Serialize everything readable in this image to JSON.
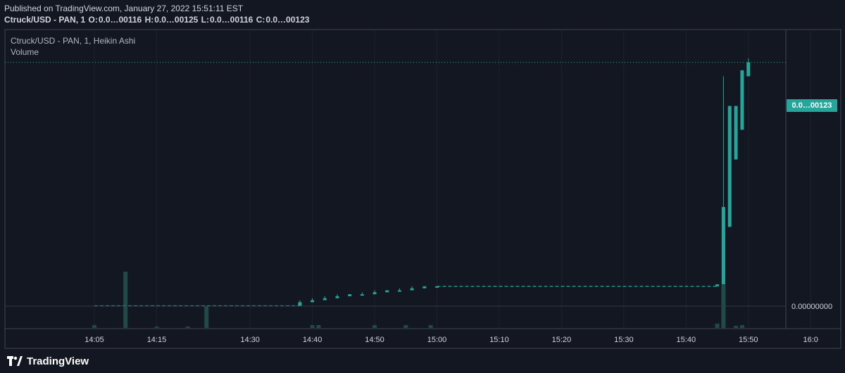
{
  "header": {
    "published": "Published on TradingView.com, January 27, 2022 15:51:11 EST",
    "symbol": "Ctruck/USD - PAN, 1",
    "o_label": "O:",
    "o_value": "0.0…00116",
    "h_label": "H:",
    "h_value": "0.0…00125",
    "l_label": "L:",
    "l_value": "0.0…00116",
    "c_label": "C:",
    "c_value": "0.0…00123"
  },
  "legend": {
    "symbol_line": "Ctruck/USD - PAN, 1, Heikin Ashi",
    "volume_label": "Volume"
  },
  "price_axis": {
    "last_price_badge": "0.0…00123",
    "zero_label": "0.00000000"
  },
  "footer": {
    "brand": "TradingView"
  },
  "colors": {
    "background": "#131722",
    "up": "#26a69a",
    "volume_up": "#1f4a45",
    "grid": "#1e222d",
    "text": "#d1d4dc"
  },
  "chart_data": {
    "type": "candlestick",
    "style": "Heikin Ashi",
    "interval": "1",
    "time_axis": {
      "start": "14:00",
      "ticks": [
        "14:05",
        "14:15",
        "14:30",
        "14:40",
        "14:50",
        "15:00",
        "15:10",
        "15:20",
        "15:30",
        "15:40",
        "15:50",
        "16:00"
      ],
      "tick_display": [
        "14:05",
        "14:15",
        "14:30",
        "14:40",
        "14:50",
        "15:00",
        "15:10",
        "15:20",
        "15:30",
        "15:40",
        "15:50",
        "16:0"
      ]
    },
    "price_range": [
      0.0,
      0.00135
    ],
    "last_price": 0.00123,
    "grid": true,
    "candles": [
      {
        "t": "14:05",
        "o": 0.0,
        "h": 0.0,
        "l": 0.0,
        "c": 0.0
      },
      {
        "t": "14:10",
        "o": 0.0,
        "h": 0.0,
        "l": 0.0,
        "c": 0.0
      },
      {
        "t": "14:15",
        "o": 0.0,
        "h": 0.0,
        "l": 0.0,
        "c": 0.0
      },
      {
        "t": "14:20",
        "o": 0.0,
        "h": 0.0,
        "l": 0.0,
        "c": 0.0
      },
      {
        "t": "14:25",
        "o": 0.0,
        "h": 0.0,
        "l": 0.0,
        "c": 0.0
      },
      {
        "t": "14:30",
        "o": 0.0,
        "h": 0.0,
        "l": 0.0,
        "c": 0.0
      },
      {
        "t": "14:35",
        "o": 0.0,
        "h": 0.0,
        "l": 0.0,
        "c": 0.0
      },
      {
        "t": "14:38",
        "o": 0.0,
        "h": 3e-05,
        "l": 0.0,
        "c": 2e-05
      },
      {
        "t": "14:40",
        "o": 2e-05,
        "h": 4e-05,
        "l": 2e-05,
        "c": 3e-05
      },
      {
        "t": "14:42",
        "o": 3e-05,
        "h": 5e-05,
        "l": 3e-05,
        "c": 4e-05
      },
      {
        "t": "14:44",
        "o": 4e-05,
        "h": 6e-05,
        "l": 4e-05,
        "c": 5e-05
      },
      {
        "t": "14:46",
        "o": 5e-05,
        "h": 6e-05,
        "l": 5e-05,
        "c": 6e-05
      },
      {
        "t": "14:48",
        "o": 6e-05,
        "h": 7e-05,
        "l": 6e-05,
        "c": 6e-05
      },
      {
        "t": "14:50",
        "o": 6e-05,
        "h": 8e-05,
        "l": 6e-05,
        "c": 7e-05
      },
      {
        "t": "14:52",
        "o": 7e-05,
        "h": 8e-05,
        "l": 7e-05,
        "c": 8e-05
      },
      {
        "t": "14:54",
        "o": 8e-05,
        "h": 9e-05,
        "l": 8e-05,
        "c": 8e-05
      },
      {
        "t": "14:56",
        "o": 8e-05,
        "h": 0.0001,
        "l": 8e-05,
        "c": 9e-05
      },
      {
        "t": "14:58",
        "o": 9e-05,
        "h": 0.0001,
        "l": 9e-05,
        "c": 0.0001
      },
      {
        "t": "15:00",
        "o": 0.0001,
        "h": 0.0001,
        "l": 0.0001,
        "c": 0.0001
      },
      {
        "t": "15:45",
        "o": 0.0001,
        "h": 0.00011,
        "l": 0.0001,
        "c": 0.00011
      },
      {
        "t": "15:46",
        "o": 0.00011,
        "h": 0.00116,
        "l": 0.00011,
        "c": 0.0005
      },
      {
        "t": "15:47",
        "o": 0.0004,
        "h": 0.00101,
        "l": 0.0004,
        "c": 0.00101
      },
      {
        "t": "15:48",
        "o": 0.00074,
        "h": 0.00101,
        "l": 0.00074,
        "c": 0.00101
      },
      {
        "t": "15:49",
        "o": 0.00089,
        "h": 0.00119,
        "l": 0.00089,
        "c": 0.00119
      },
      {
        "t": "15:50",
        "o": 0.00116,
        "h": 0.00125,
        "l": 0.00116,
        "c": 0.00123
      }
    ],
    "volume": [
      {
        "t": "14:05",
        "v": 4
      },
      {
        "t": "14:10",
        "v": 78
      },
      {
        "t": "14:15",
        "v": 1
      },
      {
        "t": "14:20",
        "v": 1
      },
      {
        "t": "14:23",
        "v": 30
      },
      {
        "t": "14:40",
        "v": 4
      },
      {
        "t": "14:41",
        "v": 4
      },
      {
        "t": "14:50",
        "v": 4
      },
      {
        "t": "14:55",
        "v": 4
      },
      {
        "t": "14:59",
        "v": 4
      },
      {
        "t": "15:45",
        "v": 6
      },
      {
        "t": "15:46",
        "v": 60
      },
      {
        "t": "15:48",
        "v": 3
      },
      {
        "t": "15:49",
        "v": 4
      }
    ]
  }
}
